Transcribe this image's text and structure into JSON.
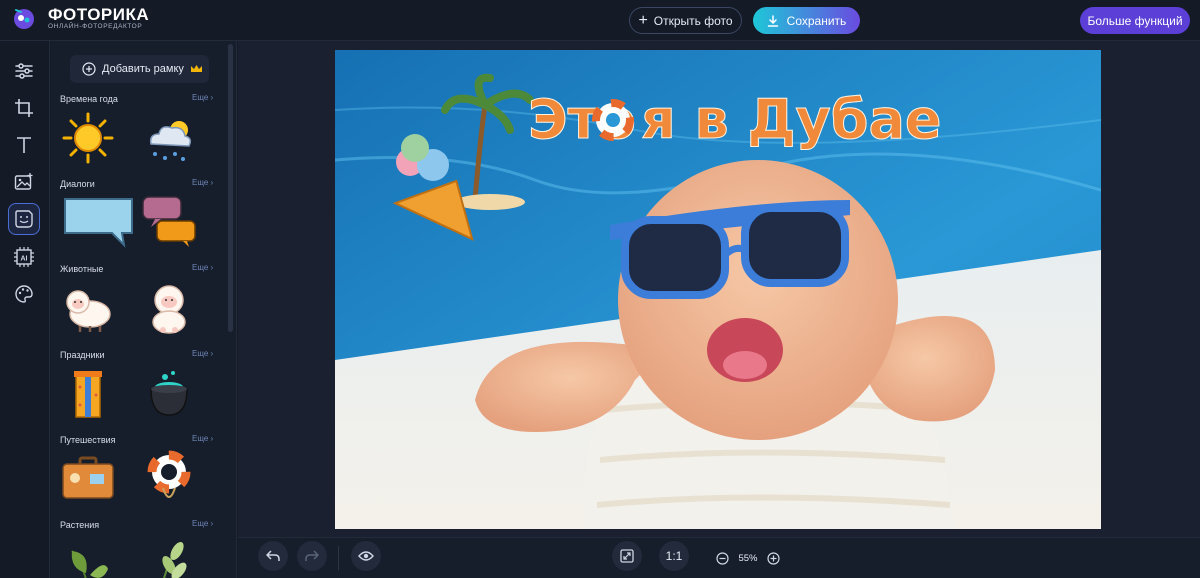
{
  "header": {
    "brand": "ФОТОРИКА",
    "brand_sub": "ОНЛАЙН-ФОТОРЕДАКТОР",
    "open_label": "Открыть фото",
    "save_label": "Сохранить",
    "more_label": "Больше функций"
  },
  "toolbar": {
    "items": [
      "adjust-icon",
      "crop-icon",
      "text-icon",
      "image-add-icon",
      "sticker-icon",
      "ai-icon",
      "palette-icon"
    ],
    "active": "sticker-icon"
  },
  "panel": {
    "add_frame_label": "Добавить рамку",
    "more_label": "Еще ›",
    "categories": [
      {
        "title": "Времена года",
        "stickers": [
          "sun-icon",
          "cloud-snow-icon"
        ]
      },
      {
        "title": "Диалоги",
        "stickers": [
          "speech-bubble-blue-icon",
          "speech-bubbles-pair-icon"
        ]
      },
      {
        "title": "Животные",
        "stickers": [
          "sheep-icon",
          "sheep-sitting-icon"
        ]
      },
      {
        "title": "Праздники",
        "stickers": [
          "gift-box-icon",
          "cauldron-icon"
        ]
      },
      {
        "title": "Путешествия",
        "stickers": [
          "suitcase-icon",
          "lifebuoy-icon"
        ]
      },
      {
        "title": "Растения",
        "stickers": [
          "leaves-icon",
          "leaves-pale-icon"
        ]
      }
    ]
  },
  "canvas": {
    "caption_part1": "Это",
    "caption_part2": "я в Дубае"
  },
  "bottom": {
    "one_to_one": "1:1",
    "zoom": "55%"
  },
  "colors": {
    "accent_purple": "#5b3fd6",
    "accent_cyan": "#1ec7d8",
    "caption_orange": "#f08a3a",
    "pool_blue": "#1f86c8"
  }
}
